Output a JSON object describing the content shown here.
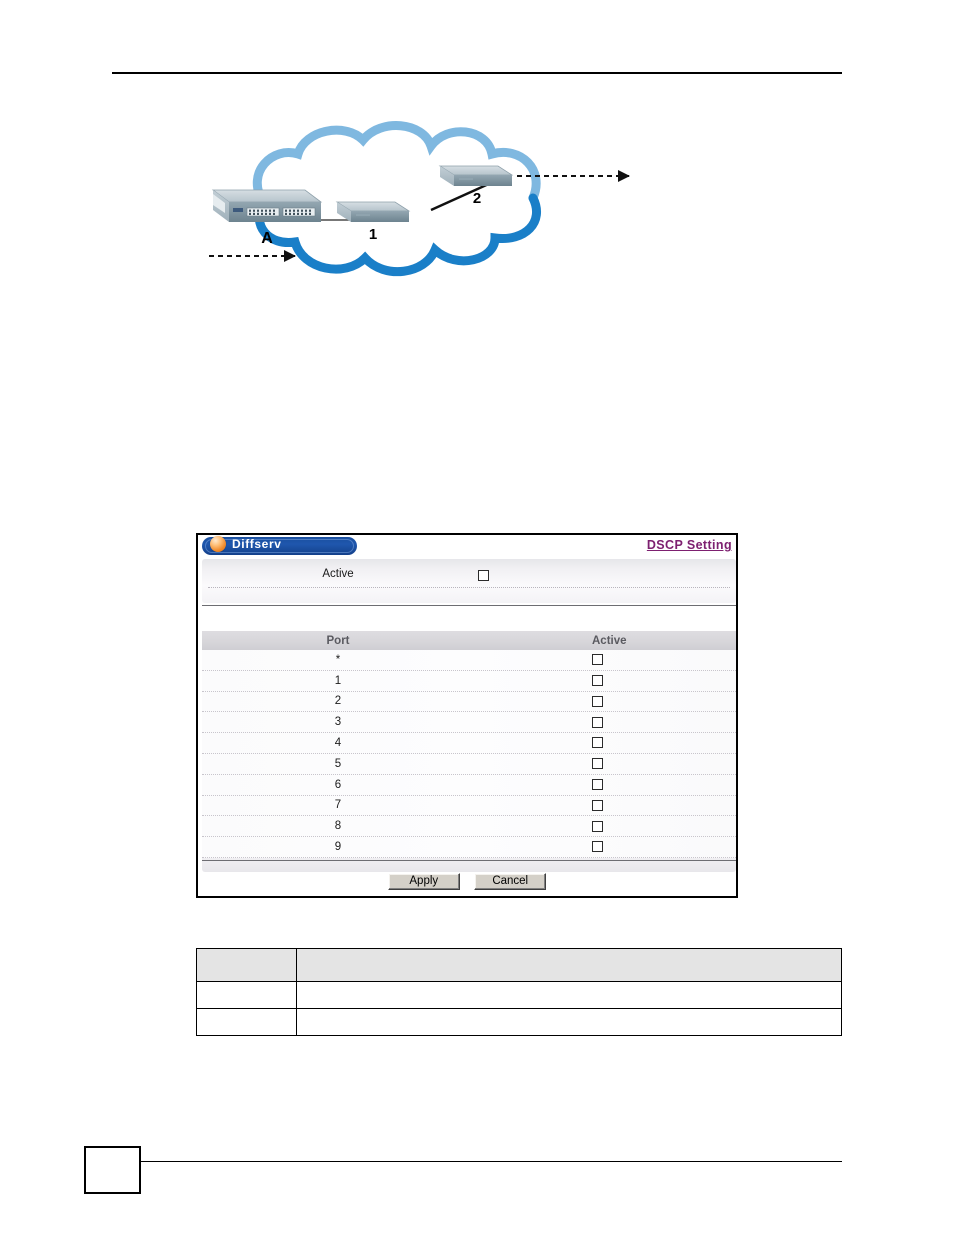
{
  "page": {
    "number": "",
    "header_rule": true,
    "footer_rule": true
  },
  "figure": {
    "name": "network-topology-diagram",
    "description": "Cloud network with an edge switch and two internal devices",
    "cloud_fill": "#ffffff",
    "cloud_stroke_top": "#7fb8e0",
    "cloud_stroke_bottom": "#1a7fc8",
    "device_body": "#aebdc6",
    "device_top": "#cdd7dd",
    "device_front": "#5d7380",
    "nodes": [
      {
        "id": "A",
        "label": "A",
        "type": "rack-switch"
      },
      {
        "id": "1",
        "label": "1",
        "type": "device"
      },
      {
        "id": "2",
        "label": "2",
        "type": "device"
      }
    ],
    "links": [
      {
        "from": "A",
        "to": "1",
        "style": "solid"
      },
      {
        "from": "1",
        "to": "2",
        "style": "solid"
      }
    ],
    "flows": [
      {
        "id": "ingress",
        "style": "dashed",
        "direction": "right"
      },
      {
        "id": "egress",
        "style": "dashed",
        "direction": "right"
      }
    ]
  },
  "panel": {
    "title": "Diffserv",
    "title_icon": "orange-orb-icon",
    "link": "DSCP Setting",
    "accent_title_bg": "#1a4fa0",
    "accent_link": "#7d2070",
    "form": {
      "active_label": "Active",
      "active_checked": false
    },
    "table": {
      "columns": [
        "Port",
        "Active"
      ],
      "rows": [
        {
          "port": "*",
          "active": false
        },
        {
          "port": "1",
          "active": false
        },
        {
          "port": "2",
          "active": false
        },
        {
          "port": "3",
          "active": false
        },
        {
          "port": "4",
          "active": false
        },
        {
          "port": "5",
          "active": false
        },
        {
          "port": "6",
          "active": false
        },
        {
          "port": "7",
          "active": false
        },
        {
          "port": "8",
          "active": false
        },
        {
          "port": "9",
          "active": false
        }
      ]
    },
    "buttons": {
      "apply": "Apply",
      "cancel": "Cancel"
    }
  },
  "description_table": {
    "headers": [
      "",
      ""
    ],
    "rows": [
      [
        "",
        ""
      ],
      [
        "",
        ""
      ]
    ]
  }
}
